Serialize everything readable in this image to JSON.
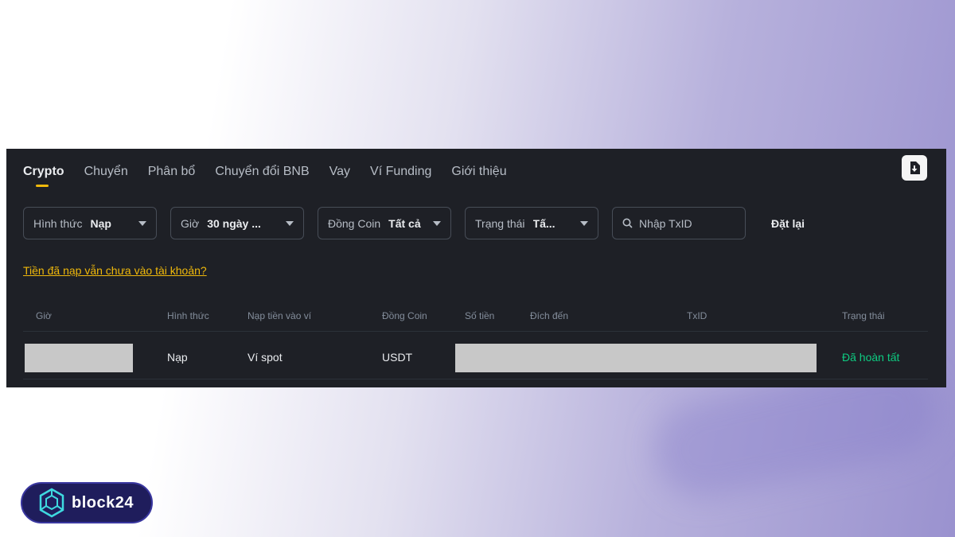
{
  "tabs": [
    {
      "label": "Crypto",
      "active": true
    },
    {
      "label": "Chuyển"
    },
    {
      "label": "Phân bổ"
    },
    {
      "label": "Chuyển đổi BNB"
    },
    {
      "label": "Vay"
    },
    {
      "label": "Ví Funding"
    },
    {
      "label": "Giới thiệu"
    }
  ],
  "filters": {
    "type": {
      "label": "Hình thức",
      "value": "Nạp"
    },
    "time": {
      "label": "Giờ",
      "value": "30 ngày ..."
    },
    "coin": {
      "label": "Đồng Coin",
      "value": "Tất cả"
    },
    "status": {
      "label": "Trạng thái",
      "value": "Tấ..."
    },
    "search": {
      "placeholder": "Nhập TxID"
    },
    "reset_label": "Đặt lại"
  },
  "hint_link": "Tiền đã nạp vẫn chưa vào tài khoản?",
  "table": {
    "headers": [
      "Giờ",
      "Hình thức",
      "Nạp tiền vào ví",
      "Đồng Coin",
      "Số tiền",
      "Đích đến",
      "TxID",
      "Trạng thái"
    ],
    "rows": [
      {
        "type": "Nạp",
        "wallet": "Ví spot",
        "coin": "USDT",
        "status": "Đã hoàn tất"
      }
    ]
  },
  "brand": {
    "name": "block24"
  },
  "colors": {
    "accent": "#f0b90b",
    "success": "#0ecb81",
    "panel": "#1e2026"
  }
}
